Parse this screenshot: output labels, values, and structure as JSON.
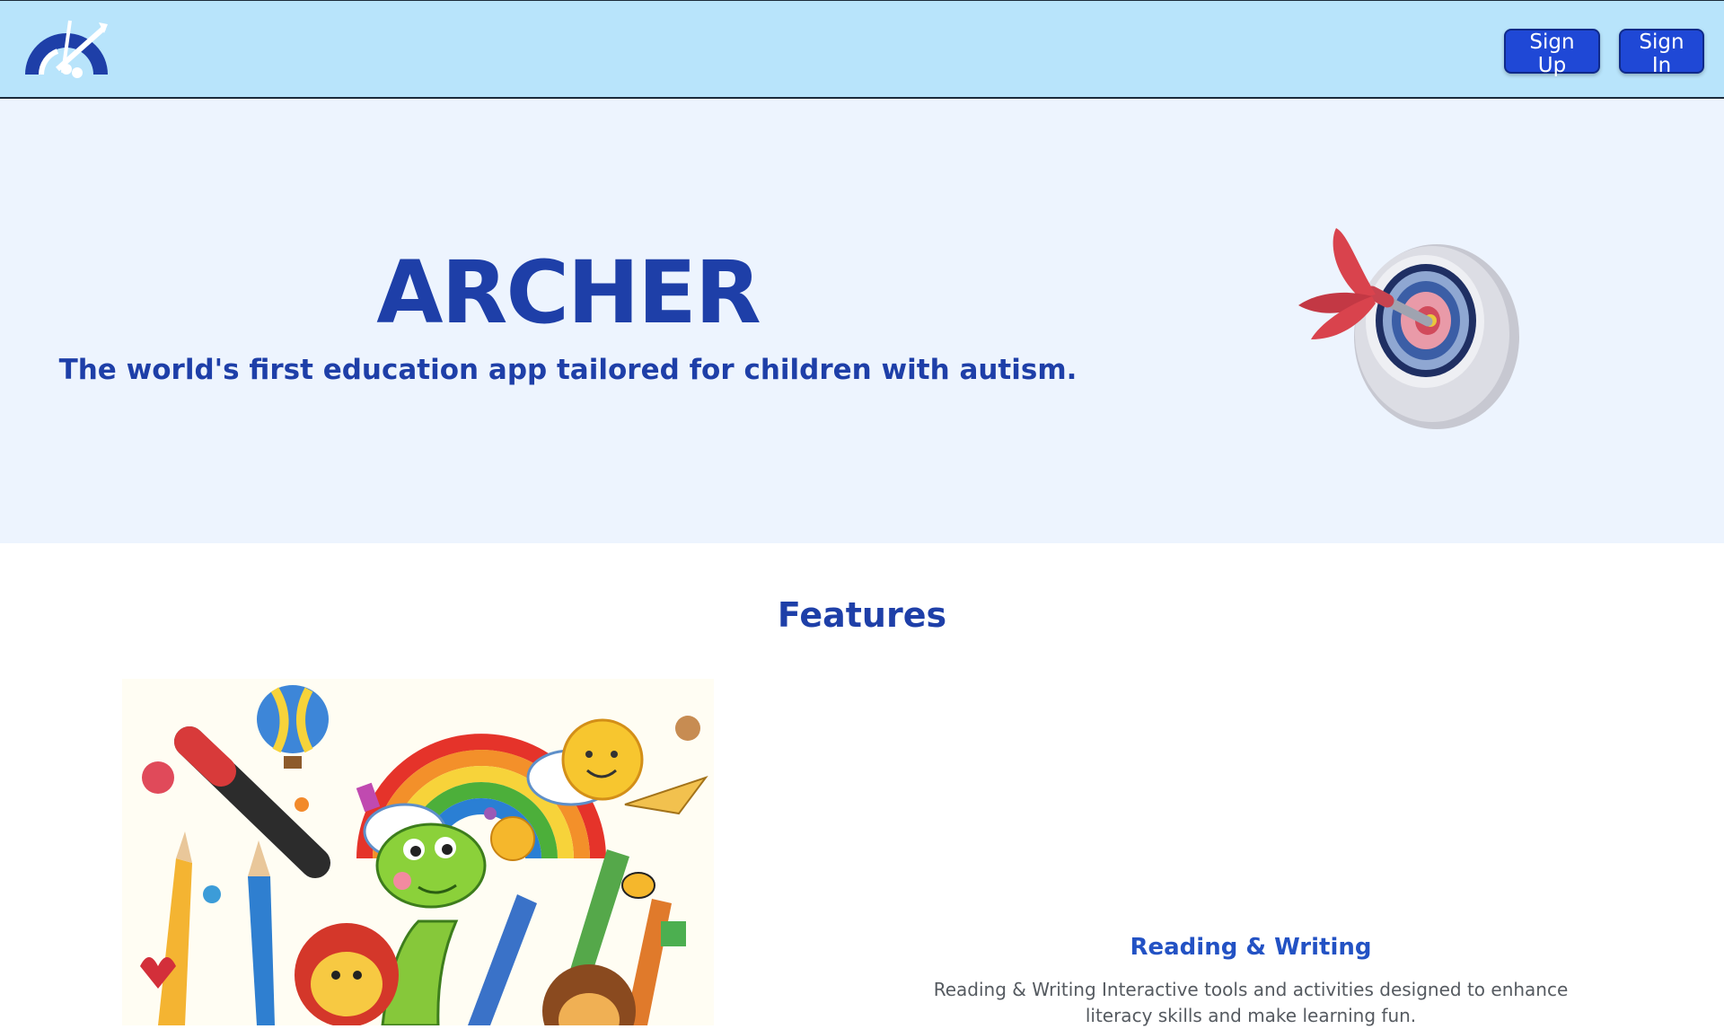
{
  "nav": {
    "signup_label": "Sign Up",
    "signin_label": "Sign In"
  },
  "hero": {
    "title": "ARCHER",
    "subtitle": "The world's first education app tailored for children with autism."
  },
  "features": {
    "heading": "Features",
    "items": [
      {
        "title": "Reading & Writing",
        "description": "Reading & Writing Interactive tools and activities designed to enhance literacy skills and make learning fun.",
        "image_icon": "colorful-doodle-illustration"
      }
    ]
  },
  "colors": {
    "navbar_bg": "#b8e4fb",
    "hero_bg": "#edf4fe",
    "brand_blue": "#1e3fa8",
    "button_blue": "#1f48d6",
    "body_text": "#555a60"
  }
}
